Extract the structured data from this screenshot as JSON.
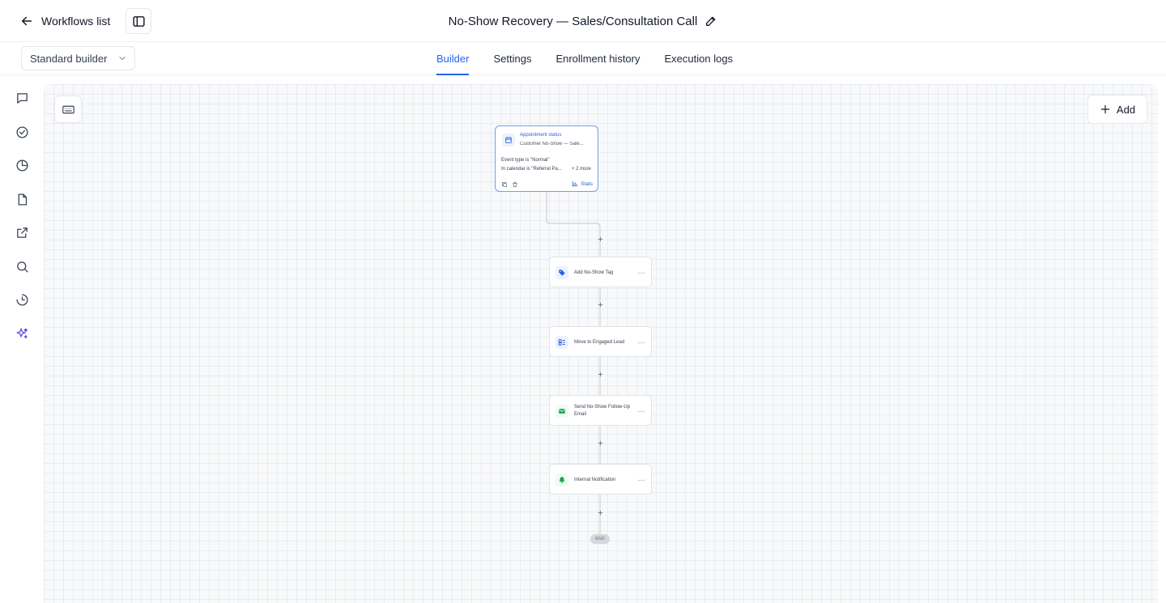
{
  "header": {
    "back_label": "Workflows list",
    "workflow_title": "No-Show Recovery — Sales/Consultation Call"
  },
  "subbar": {
    "builder_mode": "Standard builder",
    "tabs": [
      {
        "label": "Builder",
        "active": true
      },
      {
        "label": "Settings",
        "active": false
      },
      {
        "label": "Enrollment history",
        "active": false
      },
      {
        "label": "Execution logs",
        "active": false
      }
    ]
  },
  "rail": {
    "icons": [
      "chat-icon",
      "check-circle-icon",
      "pie-chart-icon",
      "file-icon",
      "external-link-icon",
      "search-icon",
      "history-icon",
      "sparkles-icon"
    ],
    "accent_color": "#6d4ce0"
  },
  "canvas": {
    "add_label": "Add",
    "trigger": {
      "title": "Appointment status",
      "subtitle": "Customer No-Show — Sale...",
      "filter_1": "Event type is \"Normal\"",
      "filter_2": "In calendar is \"Referral Pa...",
      "more": "+ 2 more",
      "stats_label": "Stats",
      "border_color": "#6ea0f0"
    },
    "actions": [
      {
        "label": "Add No-Show Tag",
        "icon": "tag-icon",
        "color": "#2563eb"
      },
      {
        "label": "Move to Engaged Lead",
        "icon": "pipeline-icon",
        "color": "#2563eb"
      },
      {
        "label": "Send No-Show Follow-Up Email",
        "icon": "email-icon",
        "color": "#16a34a"
      },
      {
        "label": "Internal Notification",
        "icon": "bell-icon",
        "color": "#16a34a"
      }
    ],
    "end_label": "END"
  },
  "colors": {
    "accent": "#2563eb",
    "border": "#e5e7eb"
  }
}
